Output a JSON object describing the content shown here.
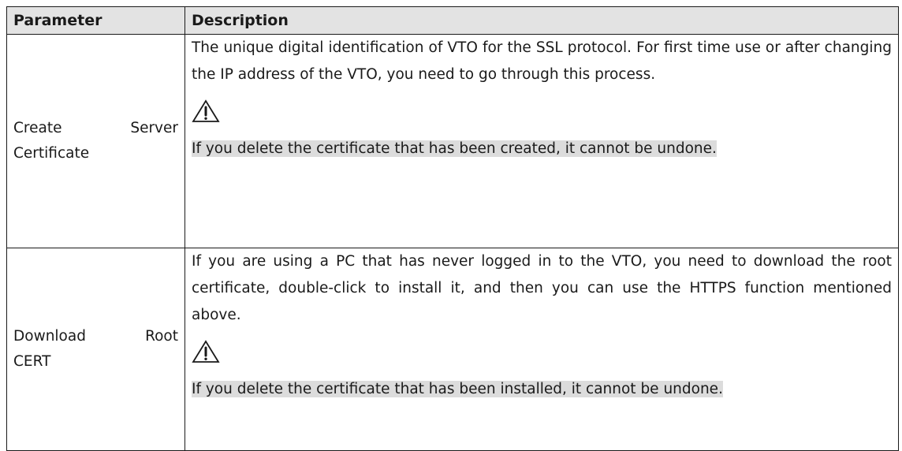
{
  "table": {
    "headers": {
      "parameter": "Parameter",
      "description": "Description"
    },
    "rows": [
      {
        "parameter_words": [
          "Create",
          "Server"
        ],
        "parameter_line2": "Certificate",
        "description": "The unique digital identification of VTO for the SSL protocol. For first time use or after changing the IP address of the VTO, you need to go through this process.",
        "warning_icon": "warning-triangle-icon",
        "note": "If you delete the certificate that has been created, it cannot be undone."
      },
      {
        "parameter_words": [
          "Download",
          "Root"
        ],
        "parameter_line2": "CERT",
        "description": "If you are using a PC that has never logged in to the VTO, you need to download the root certificate, double-click to install it, and then you can use the HTTPS function mentioned above.",
        "warning_icon": "warning-triangle-icon",
        "note": "If you delete the certificate that has been installed, it cannot be undone."
      }
    ]
  },
  "colors": {
    "header_bg": "#e3e3e3",
    "note_highlight": "#dcdcdc",
    "border": "#1a1a1a"
  }
}
